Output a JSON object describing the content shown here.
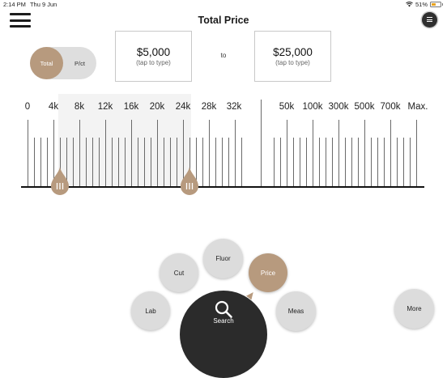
{
  "status_bar": {
    "time": "2:14 PM",
    "date": "Thu 9 Jun",
    "battery": "51%",
    "battery_level": 0.51
  },
  "header": {
    "title": "Total Price"
  },
  "mode_toggle": {
    "selected": "Total",
    "other": "P/ct"
  },
  "price_range": {
    "min": {
      "value": "$5,000",
      "hint": "(tap to type)"
    },
    "separator": "to",
    "max": {
      "value": "$25,000",
      "hint": "(tap to type)"
    }
  },
  "ruler": {
    "labels": [
      "0",
      "4k",
      "8k",
      "12k",
      "16k",
      "20k",
      "24k",
      "28k",
      "32k",
      "50k",
      "100k",
      "300k",
      "500k",
      "700k",
      "Max."
    ],
    "selected_min": "5k",
    "selected_max": "25k"
  },
  "bottom_nav": {
    "search": "Search",
    "lab": "Lab",
    "cut": "Cut",
    "fluor": "Fluor",
    "price": "Price",
    "meas": "Meas",
    "more": "More"
  },
  "colors": {
    "accent": "#b79a7e",
    "dark": "#2b2b2b",
    "button": "#dcdcdc"
  },
  "icons": {
    "menu": "hamburger-icon",
    "list": "list-icon",
    "search": "magnifier-icon",
    "handle": "grip-lines-icon",
    "wifi": "wifi-icon",
    "battery": "battery-icon"
  }
}
